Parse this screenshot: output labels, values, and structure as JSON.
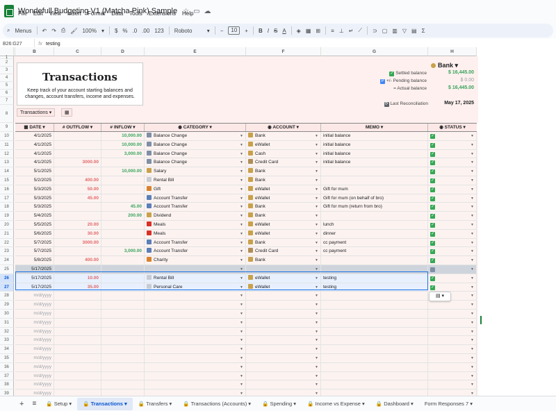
{
  "app": {
    "title": "Wondefull Budgeting V1 (Matcha Pink) Sample",
    "menu": [
      "File",
      "Edit",
      "View",
      "Insert",
      "Format",
      "Data",
      "Tools",
      "Extensions",
      "Help"
    ]
  },
  "toolbar": {
    "menus_label": "Menus",
    "zoom": "100%",
    "currency": "$",
    "percent": "%",
    "dec_decrease": ".0",
    "dec_increase": ".00",
    "number_format": "123",
    "font": "Roboto",
    "font_size": "10"
  },
  "formula_bar": {
    "name_box": "B26:G27",
    "fx": "fx",
    "content": "testing"
  },
  "columns": [
    "B",
    "C",
    "D",
    "E",
    "F",
    "G",
    "H"
  ],
  "hero": {
    "title": "Transactions",
    "description": "Keep track of your account starting balances and changes, account transfers, income and expenses."
  },
  "balances": {
    "account": "Bank",
    "settled_label": "Settled balance",
    "settled_value": "$ 16,445.00",
    "pending_label": "+/- Pending balance",
    "pending_value": "$ 0.00",
    "actual_label": "= Actual balance",
    "actual_value": "$ 16,445.00",
    "reconcile_label": "Last Reconciliation",
    "reconcile_date": "May 17, 2025"
  },
  "filter_chip": "Transactions",
  "headers": {
    "date": "DATE",
    "outflow": "OUTFLOW",
    "inflow": "INFLOW",
    "category": "CATEGORY",
    "account": "ACCOUNT",
    "memo": "MEMO",
    "status": "STATUS"
  },
  "rows": [
    {
      "n": "10",
      "date": "4/1/2025",
      "out": "",
      "in": "10,000.00",
      "cat": "Balance Change",
      "acc": "Bank",
      "memo": "initial balance"
    },
    {
      "n": "11",
      "date": "4/1/2025",
      "out": "",
      "in": "10,000.00",
      "cat": "Balance Change",
      "acc": "eWallet",
      "memo": "initial balance"
    },
    {
      "n": "12",
      "date": "4/1/2025",
      "out": "",
      "in": "3,000.00",
      "cat": "Balance Change",
      "acc": "Cash",
      "memo": "initial balance"
    },
    {
      "n": "13",
      "date": "4/1/2025",
      "out": "3000.00",
      "in": "",
      "cat": "Balance Change",
      "acc": "Credit Card",
      "memo": "initial balance"
    },
    {
      "n": "14",
      "date": "5/1/2025",
      "out": "",
      "in": "10,000.00",
      "cat": "Salary",
      "acc": "Bank",
      "memo": ""
    },
    {
      "n": "15",
      "date": "5/2/2025",
      "out": "400.00",
      "in": "",
      "cat": "Rental Bill",
      "acc": "Bank",
      "memo": ""
    },
    {
      "n": "16",
      "date": "5/3/2025",
      "out": "50.00",
      "in": "",
      "cat": "Gift",
      "acc": "eWallet",
      "memo": "Gift for mum"
    },
    {
      "n": "17",
      "date": "5/3/2025",
      "out": "45.00",
      "in": "",
      "cat": "Account Transfer",
      "acc": "eWallet",
      "memo": "Gift for mum (on behalf of bro)"
    },
    {
      "n": "18",
      "date": "5/3/2025",
      "out": "",
      "in": "45.00",
      "cat": "Account Transfer",
      "acc": "Bank",
      "memo": "Gift for mum (return from bro)"
    },
    {
      "n": "19",
      "date": "5/4/2025",
      "out": "",
      "in": "200.00",
      "cat": "Dividend",
      "acc": "Bank",
      "memo": ""
    },
    {
      "n": "20",
      "date": "5/5/2025",
      "out": "20.00",
      "in": "",
      "cat": "Meals",
      "acc": "eWallet",
      "memo": "lunch"
    },
    {
      "n": "21",
      "date": "5/6/2025",
      "out": "30.00",
      "in": "",
      "cat": "Meals",
      "acc": "eWallet",
      "memo": "dinner"
    },
    {
      "n": "22",
      "date": "5/7/2025",
      "out": "3000.00",
      "in": "",
      "cat": "Account Transfer",
      "acc": "Bank",
      "memo": "cc payment"
    },
    {
      "n": "23",
      "date": "5/7/2025",
      "out": "",
      "in": "3,000.00",
      "cat": "Account Transfer",
      "acc": "Credit Card",
      "memo": "cc payment"
    },
    {
      "n": "24",
      "date": "5/8/2025",
      "out": "400.00",
      "in": "",
      "cat": "Charity",
      "acc": "Bank",
      "memo": ""
    },
    {
      "n": "25",
      "date": "5/17/2025",
      "out": "",
      "in": "",
      "cat": "",
      "acc": "",
      "memo": ""
    },
    {
      "n": "26",
      "date": "5/17/2025",
      "out": "10.00",
      "in": "",
      "cat": "Rental Bill",
      "acc": "eWallet",
      "memo": "testing"
    },
    {
      "n": "27",
      "date": "5/17/2025",
      "out": "35.00",
      "in": "",
      "cat": "Personal Care",
      "acc": "eWallet",
      "memo": "testing"
    }
  ],
  "empty_rows": [
    "28",
    "29",
    "30",
    "31",
    "32",
    "33",
    "34",
    "35",
    "36",
    "37",
    "38",
    "39"
  ],
  "date_placeholder": "m/d/yyyy",
  "tabs": [
    {
      "label": "Setup"
    },
    {
      "label": "Transactions",
      "active": true
    },
    {
      "label": "Transfers"
    },
    {
      "label": "Transactions (Accounts)"
    },
    {
      "label": "Spending"
    },
    {
      "label": "Income vs Expense"
    },
    {
      "label": "Dashboard"
    },
    {
      "label": "Form Responses 7"
    }
  ],
  "colors": {
    "outflow": "#e06666",
    "inflow": "#38a35b",
    "header_bg": "#fce8e6",
    "accent": "#1a73e8"
  }
}
